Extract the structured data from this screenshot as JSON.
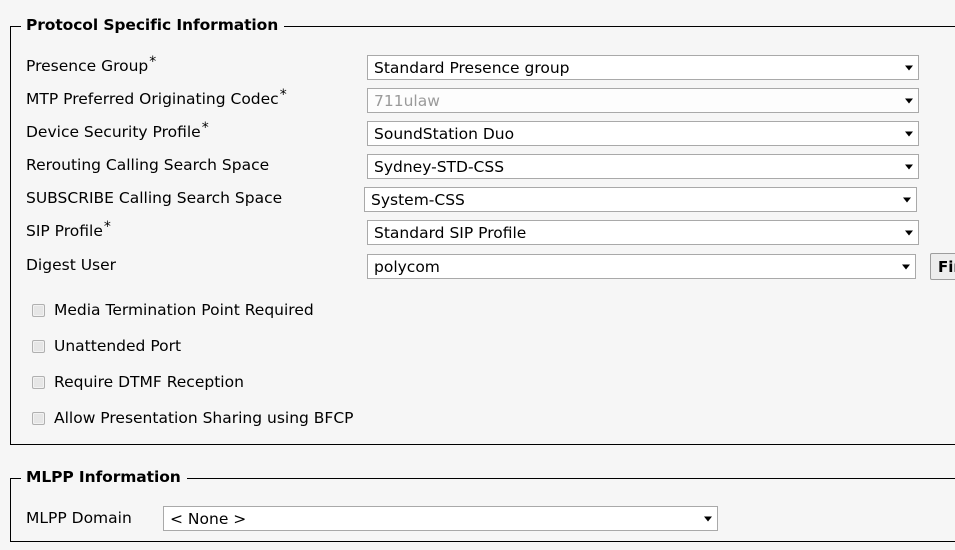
{
  "page": {
    "background_color": "#f6f6f6",
    "text_color": "#000000"
  },
  "protocol_section": {
    "legend": "Protocol Specific Information",
    "fields": [
      {
        "label": "Presence Group",
        "required_marker": "*",
        "control": "dropdown",
        "value": "Standard Presence group",
        "disabled": false
      },
      {
        "label": "MTP Preferred Originating Codec",
        "required_marker": "*",
        "control": "dropdown",
        "value": "711ulaw",
        "disabled": true
      },
      {
        "label": "Device Security Profile",
        "required_marker": "*",
        "control": "dropdown",
        "value": "SoundStation Duo",
        "disabled": false
      },
      {
        "label": "Rerouting Calling Search Space",
        "required_marker": "",
        "control": "dropdown",
        "value": "Sydney-STD-CSS",
        "disabled": false
      },
      {
        "label": "SUBSCRIBE Calling Search Space",
        "required_marker": "",
        "control": "dropdown",
        "value": "System-CSS",
        "disabled": false
      },
      {
        "label": "SIP Profile",
        "required_marker": "*",
        "control": "dropdown",
        "value": "Standard SIP Profile",
        "disabled": false
      },
      {
        "label": "Digest User",
        "required_marker": "",
        "control": "dropdown",
        "value": "polycom",
        "disabled": false
      }
    ],
    "find_button": {
      "label": "Find",
      "visible_text": "Fi"
    },
    "checkboxes": [
      {
        "label": "Media Termination Point Required",
        "checked": false
      },
      {
        "label": "Unattended Port",
        "checked": false
      },
      {
        "label": "Require DTMF Reception",
        "checked": false
      },
      {
        "label": "Allow Presentation Sharing using BFCP",
        "checked": false
      }
    ]
  },
  "mlpp_section": {
    "legend": "MLPP Information",
    "fields": [
      {
        "label": "MLPP Domain",
        "required_marker": "",
        "control": "dropdown",
        "value": "< None >",
        "disabled": false
      }
    ]
  }
}
